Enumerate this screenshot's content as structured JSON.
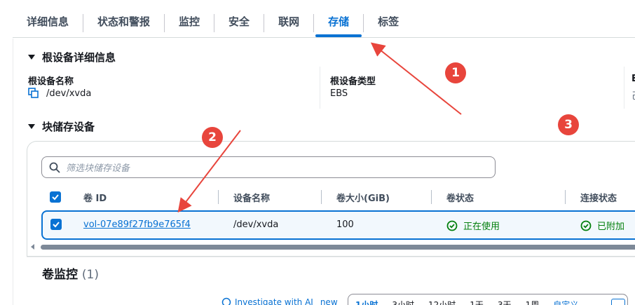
{
  "tabs": [
    {
      "label": "详细信息"
    },
    {
      "label": "状态和警报"
    },
    {
      "label": "监控"
    },
    {
      "label": "安全"
    },
    {
      "label": "联网"
    },
    {
      "label": "存储",
      "active": true
    },
    {
      "label": "标签"
    }
  ],
  "root_device": {
    "section_title": "根设备详细信息",
    "name_label": "根设备名称",
    "name_value": "/dev/xvda",
    "type_label": "根设备类型",
    "type_value": "EBS",
    "third_label_fragment": "E",
    "third_value_fragment": "己"
  },
  "block_devices": {
    "section_title": "块储存设备",
    "search_placeholder": "筛选块储存设备",
    "columns": [
      "卷 ID",
      "设备名称",
      "卷大小(GiB)",
      "卷状态",
      "连接状态"
    ],
    "rows": [
      {
        "selected": true,
        "volume_id": "vol-07e89f27fb9e765f4",
        "device_name": "/dev/xvda",
        "size": "100",
        "volume_state": "正在使用",
        "attach_state": "已附加"
      }
    ]
  },
  "volume_monitoring": {
    "title": "卷监控",
    "count": "(1)",
    "ai_link": "Investigate with AI",
    "ai_badge": "new",
    "time_ranges": [
      "1小时",
      "3小时",
      "12小时",
      "1天",
      "3天",
      "1周",
      "自定义"
    ],
    "active_range": "1小时"
  },
  "annotations": [
    "1",
    "2",
    "3"
  ],
  "colors": {
    "accent": "#0972d3",
    "success": "#037f0c",
    "annotation": "#e8453c"
  }
}
